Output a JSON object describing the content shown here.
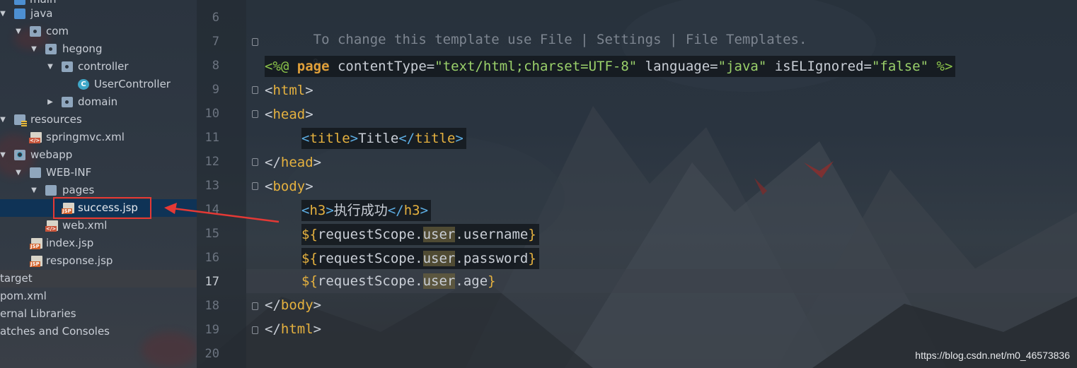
{
  "tree": {
    "rows": [
      {
        "label": "main",
        "icon": "folder-blue-icon"
      },
      {
        "label": "java",
        "icon": "folder-blue-icon"
      },
      {
        "label": "com",
        "icon": "package-icon"
      },
      {
        "label": "hegong",
        "icon": "package-icon"
      },
      {
        "label": "controller",
        "icon": "package-icon"
      },
      {
        "label": "UserController",
        "icon": "class-icon"
      },
      {
        "label": "domain",
        "icon": "package-icon"
      },
      {
        "label": "resources",
        "icon": "resources-folder-icon"
      },
      {
        "label": "springmvc.xml",
        "icon": "xml-file-icon"
      },
      {
        "label": "webapp",
        "icon": "web-folder-icon"
      },
      {
        "label": "WEB-INF",
        "icon": "folder-icon"
      },
      {
        "label": "pages",
        "icon": "folder-icon"
      },
      {
        "label": "success.jsp",
        "icon": "jsp-file-icon"
      },
      {
        "label": "web.xml",
        "icon": "xml-file-icon"
      },
      {
        "label": "index.jsp",
        "icon": "jsp-file-icon"
      },
      {
        "label": "response.jsp",
        "icon": "jsp-file-icon"
      },
      {
        "label": "target",
        "icon": ""
      },
      {
        "label": "pom.xml",
        "icon": ""
      },
      {
        "label": "ernal Libraries",
        "icon": ""
      },
      {
        "label": "atches and Consoles",
        "icon": ""
      }
    ],
    "selected_file": "success.jsp"
  },
  "editor": {
    "line_numbers": [
      "6",
      "7",
      "8",
      "9",
      "10",
      "11",
      "12",
      "13",
      "14",
      "15",
      "16",
      "17",
      "18",
      "19",
      "20"
    ],
    "current_line": "17",
    "lines": {
      "l6": "  To change this template use File | Settings | File Templates.",
      "l7": "--%>",
      "l8": {
        "open": "<%@ ",
        "page": "page",
        "ct_attr": " contentType=",
        "ct_val": "\"text/html;charset=UTF-8\"",
        "lang_attr": " language=",
        "lang_val": "\"java\"",
        "el_attr": " isELIgnored=",
        "el_val": "\"false\"",
        "close": " %>"
      },
      "l9": {
        "lt": "<",
        "tag": "html",
        "gt": ">"
      },
      "l10": {
        "lt": "<",
        "tag": "head",
        "gt": ">"
      },
      "l11": {
        "lt": "<",
        "tag": "title",
        "gt": ">",
        "text": "Title",
        "lt2": "</",
        "tag2": "title",
        "gt2": ">"
      },
      "l12": {
        "lt": "</",
        "tag": "head",
        "gt": ">"
      },
      "l13": {
        "lt": "<",
        "tag": "body",
        "gt": ">"
      },
      "l14": {
        "lt": "<",
        "tag": "h3",
        "gt": ">",
        "text": "执行成功",
        "lt2": "</",
        "tag2": "h3",
        "gt2": ">"
      },
      "l15": {
        "open": "${",
        "scope": "requestScope.",
        "user": "user",
        "prop": ".username",
        "close": "}"
      },
      "l16": {
        "open": "${",
        "scope": "requestScope.",
        "user": "user",
        "prop": ".password",
        "close": "}"
      },
      "l17": {
        "open": "${",
        "scope": "requestScope.",
        "user": "user",
        "prop": ".age",
        "close": "}"
      },
      "l18": {
        "lt": "</",
        "tag": "body",
        "gt": ">"
      },
      "l19": {
        "lt": "</",
        "tag": "html",
        "gt": ">"
      }
    }
  },
  "watermark": "https://blog.csdn.net/m0_46573836",
  "colors": {
    "selection": "#0f3356",
    "annotation_red": "#e53935",
    "jsp_tag": "#8bc34a",
    "keyword": "#e0a03a"
  }
}
